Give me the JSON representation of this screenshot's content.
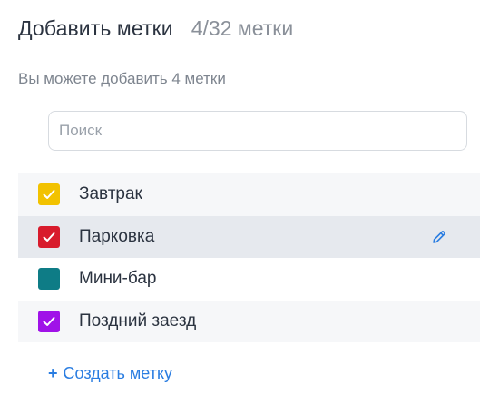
{
  "header": {
    "title": "Добавить метки",
    "count": "4/32 метки"
  },
  "hint": "Вы можете добавить 4 метки",
  "search": {
    "placeholder": "Поиск",
    "value": ""
  },
  "tags": [
    {
      "label": "Завтрак",
      "color": "#f2c200",
      "checked": true
    },
    {
      "label": "Парковка",
      "color": "#d81b2c",
      "checked": true,
      "state": "hovered"
    },
    {
      "label": "Мини-бар",
      "color": "#0e7c86",
      "checked": false
    },
    {
      "label": "Поздний заезд",
      "color": "#a012e8",
      "checked": true
    }
  ],
  "create": {
    "icon": "plus-icon",
    "label": "Создать метку"
  },
  "colors": {
    "accent": "#2a7de1",
    "text": "#2b3340",
    "muted": "#7e858f"
  }
}
